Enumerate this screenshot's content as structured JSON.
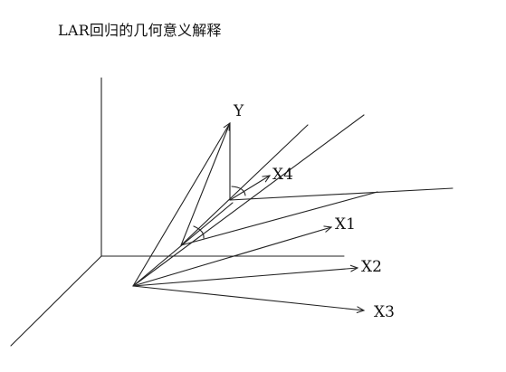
{
  "title": "LAR回归的几何意义解释",
  "labels": {
    "y": "Y",
    "x1": "X1",
    "x2": "X2",
    "x3": "X3",
    "x4": "X4"
  },
  "colors": {
    "line": "#222222",
    "background": "#ffffff"
  }
}
